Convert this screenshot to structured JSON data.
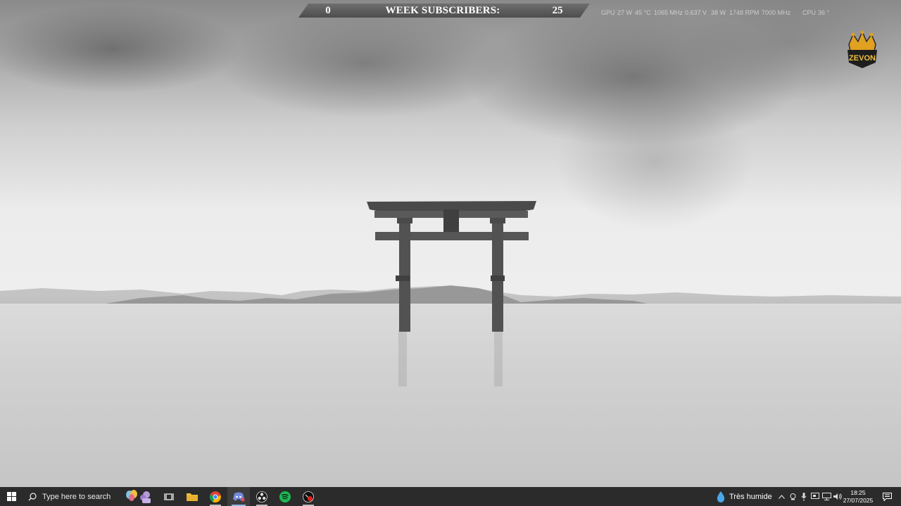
{
  "banner": {
    "left_count": "0",
    "title": "WEEK SUBSCRIBERS:",
    "right_count": "25"
  },
  "hardware_overlay": {
    "gpu_label": "GPU",
    "gpu_power": "27 W",
    "gpu_temp": "45 °C",
    "gpu_clock": "1065 MHz",
    "gpu_voltage": "0.637 V",
    "gpu_power2": "38 W",
    "fan_rpm": "1748 RPM",
    "mem_clock": "7000 MHz",
    "cpu_label": "CPU",
    "cpu_value": "36 °"
  },
  "logo": {
    "text": "ZEVON"
  },
  "taskbar": {
    "search_placeholder": "Type here to search",
    "apps": [
      "file-explorer",
      "chrome",
      "discord",
      "obs",
      "spotify",
      "recorder"
    ],
    "weather_text": "Très humide",
    "time": "18:25",
    "date": "27/07/2025"
  },
  "colors": {
    "taskbar_bg": "#2b2b2b",
    "banner_bg": "#5a5a5a",
    "active_indicator": "#8fb8e8"
  }
}
